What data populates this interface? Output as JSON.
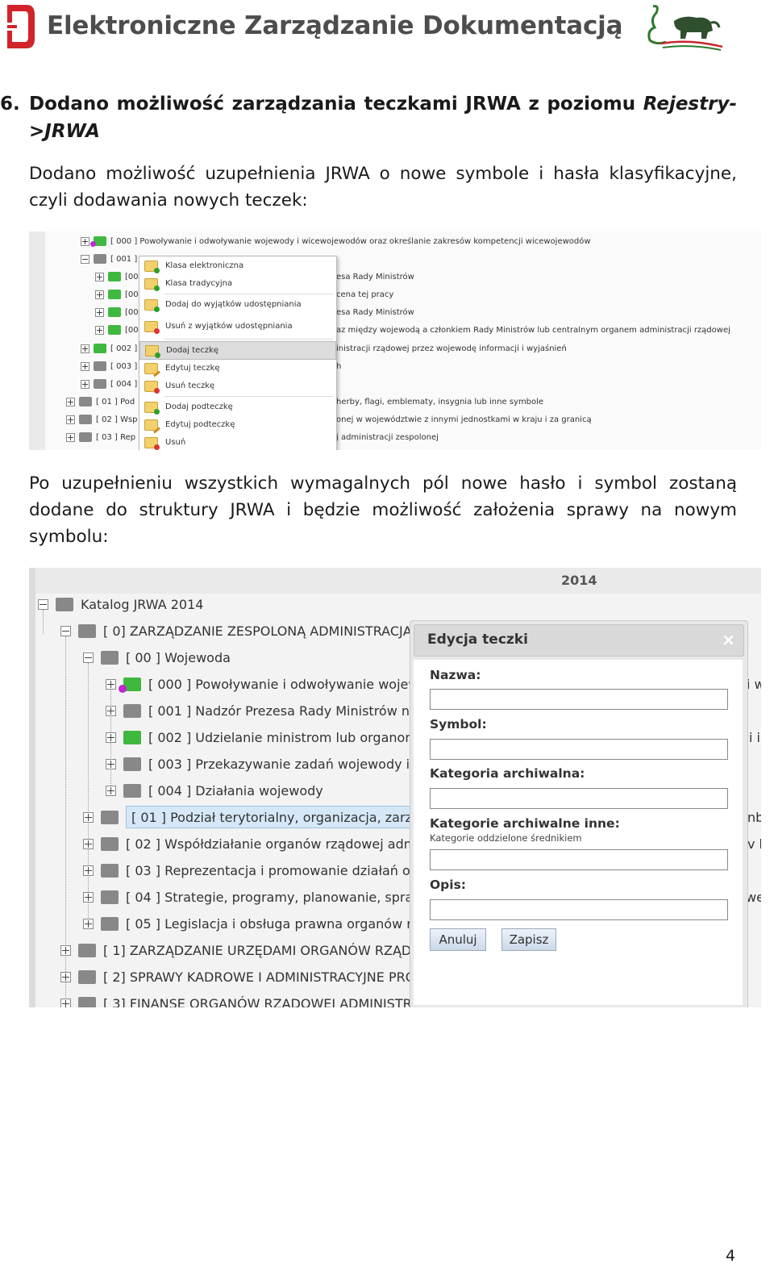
{
  "header": {
    "title": "Elektroniczne Zarządzanie Dokumentacją",
    "logo_left": "eZD-logo-icon",
    "logo_right": "bison-logo-icon"
  },
  "section": {
    "number": "6.",
    "heading_line1": "Dodano możliwość zarządzania teczkami JRWA z poziomu Rejestry-",
    "heading_line1_plain": "Dodano możliwość zarządzania teczkami JRWA z poziomu",
    "heading_line1_italic": "Rejestry-",
    "heading_line2": ">JRWA",
    "para1_line1": "Dodano możliwość uzupełnienia JRWA o nowe symbole i hasła klasyfikacyjne,",
    "para1_line2": "czyli dodawania nowych teczek:",
    "para2_line1": "Po uzupełnieniu wszystkich wymagalnych pól nowe hasło i symbol zostaną",
    "para2_line2": "dodane do struktury JRWA i będzie możliwość założenia sprawy na nowym",
    "para2_line3": "symbolu:"
  },
  "shot1": {
    "rows": [
      {
        "text": "[ 000 ] Powoływanie i odwoływanie wojewody i wicewojewodów oraz określanie zakresów kompetencji wicewojewodów"
      },
      {
        "text": "[ 001 ]"
      },
      {
        "text": "[00"
      },
      {
        "text": "[00"
      },
      {
        "text": "[00"
      },
      {
        "text": "[00"
      },
      {
        "text": "[ 002 ]"
      },
      {
        "text": "[ 003 ]"
      },
      {
        "text": "[ 004 ]"
      },
      {
        "text": "[ 01 ] Pod"
      },
      {
        "text": "[ 02 ] Wsp"
      },
      {
        "text": "[ 03 ] Rep"
      }
    ],
    "right_texts": [
      "esa Rady Ministrów",
      "cena tej pracy",
      "esa Rady Ministrów",
      "az między wojewodą a członkiem Rady Ministrów lub centralnym organem administracji rządowej",
      "inistracji rządowej przez wojewodę informacji i wyjaśnień",
      "h",
      "herby, flagi, emblematy, insygnia lub inne symbole",
      "onej w województwie z innymi jednostkami w kraju i za granicą",
      "j administracji zespolonej"
    ],
    "menu": [
      "Klasa elektroniczna",
      "Klasa tradycyjna",
      "Dodaj do wyjątków udostępniania",
      "Usuń z wyjątków udostępniania",
      "Dodaj teczkę",
      "Edytuj teczkę",
      "Usuń teczkę",
      "Dodaj podteczkę",
      "Edytuj podteczkę",
      "Usuń"
    ]
  },
  "shot2": {
    "year": "2014",
    "rows": [
      "Katalog JRWA 2014",
      "[  0] ZARZĄDZANIE ZESPOLONĄ ADMINISTRACJĄ",
      "[ 00 ] Wojewoda",
      "[ 000 ] Powoływanie i odwoływanie wojewo",
      "[ 001 ] Nadzór Prezesa Rady Ministrów nad w",
      "[ 002 ] Udzielanie ministrom lub organom ce",
      "[ 003 ] Przekazywanie zadań wojewody inny",
      "[ 004 ] Działania wojewody",
      "[ 01 ] Podział terytorialny, organizacja, zarządza",
      "[ 02 ] Współdziałanie organów rządowej admin",
      "[ 03 ] Reprezentacja i promowanie działań orga",
      "[ 04 ] Strategie, programy, planowanie, sprawoz",
      "[ 05 ] Legislacja i obsługa prawna organów rząc",
      "[  1] ZARZĄDZANIE URZĘDAMI ORGANÓW RZĄDC",
      "[  2] SPRAWY KADROWE I ADMINISTRACYJNE PRO",
      "[  3] FINANSE ORGANÓW RZĄDOWEJ ADMINISTRA"
    ],
    "edge_texts": [
      "i w",
      "i i",
      "nb",
      "v k",
      "wej"
    ],
    "dialog": {
      "title": "Edycja teczki",
      "close": "×",
      "label_name": "Nazwa:",
      "label_symbol": "Symbol:",
      "label_category": "Kategoria archiwalna:",
      "label_other": "Kategorie archiwalne inne:",
      "hint_other": "Kategorie oddzielone średnikiem",
      "label_desc": "Opis:",
      "btn_cancel": "Anuluj",
      "btn_save": "Zapisz",
      "value_name": "",
      "value_symbol": "",
      "value_category": "",
      "value_other": "",
      "value_desc": ""
    }
  },
  "page_number": "4",
  "colors": {
    "accent_red": "#d2232a",
    "folder_green": "#3fb83f",
    "selection_blue": "#d6e8f7"
  }
}
